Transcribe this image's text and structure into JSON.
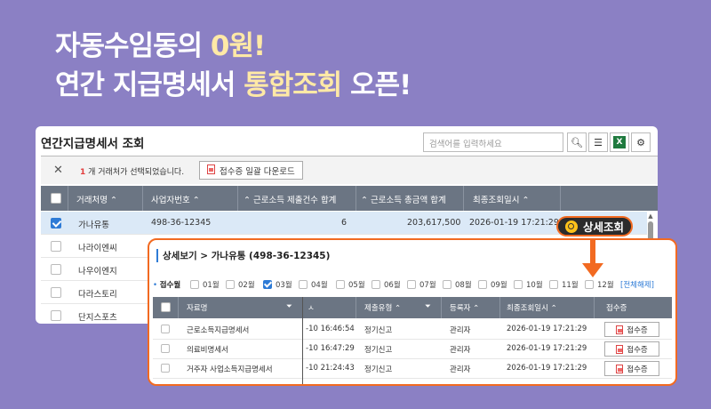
{
  "headline": {
    "line1_a": "자동수임동의 ",
    "line1_b": "0원!",
    "line2_a": "연간 지급명세서 ",
    "line2_b": "통합조회",
    "line2_c": " 오픈!"
  },
  "window": {
    "title": "연간지급명세서 조회",
    "search_placeholder": "검색어를 입력하세요",
    "selection_count": "1",
    "selection_text": " 개 거래처가 선택되었습니다.",
    "download_label": "접수증 일괄 다운로드",
    "columns": [
      "거래처명",
      "사업자번호",
      "근로소득 제출건수 합계",
      "근로소득 총금액 합계",
      "최종조회일시"
    ],
    "rows": [
      {
        "name": "가나유통",
        "biz": "498-36-12345",
        "count": "6",
        "amount": "203,617,500",
        "date": "2026-01-19 17:21:29",
        "checked": true
      },
      {
        "name": "나라이엔씨",
        "checked": false
      },
      {
        "name": "나우이엔지",
        "checked": false
      },
      {
        "name": "다라스토리",
        "checked": false
      },
      {
        "name": "단지스포츠",
        "checked": false
      }
    ],
    "detail_button": "상세조회"
  },
  "detail": {
    "title": "상세보기 > 가나유통 (498-36-12345)",
    "month_label": "접수월",
    "months": [
      {
        "label": "01월",
        "checked": false
      },
      {
        "label": "02월",
        "checked": false
      },
      {
        "label": "03월",
        "checked": true
      },
      {
        "label": "04월",
        "checked": false
      },
      {
        "label": "05월",
        "checked": false
      },
      {
        "label": "06월",
        "checked": false
      },
      {
        "label": "07월",
        "checked": false
      },
      {
        "label": "08월",
        "checked": false
      },
      {
        "label": "09월",
        "checked": false
      },
      {
        "label": "10월",
        "checked": false
      },
      {
        "label": "11월",
        "checked": false
      },
      {
        "label": "12월",
        "checked": false
      }
    ],
    "clear_all": "[전체해제]",
    "columns": [
      "자료명",
      "제출유형",
      "등록자",
      "최종조회일시",
      "접수증"
    ],
    "rows": [
      {
        "name": "근로소득지급명세서",
        "time": "-10 16:46:54",
        "type": "정기신고",
        "reg": "관리자",
        "date": "2026-01-19 17:21:29",
        "receipt": "접수증"
      },
      {
        "name": "의료비명세서",
        "time": "-10 16:47:29",
        "type": "정기신고",
        "reg": "관리자",
        "date": "2026-01-19 17:21:29",
        "receipt": "접수증"
      },
      {
        "name": "거주자 사업소득지급명세서",
        "time": "-10 21:24:43",
        "type": "정기신고",
        "reg": "관리자",
        "date": "2026-01-19 17:21:29",
        "receipt": "접수증"
      }
    ]
  },
  "colors": {
    "background": "#8b80c4",
    "accent": "#f26a21",
    "header_gray": "#6b7583",
    "highlight_text": "#ffe9a6"
  }
}
